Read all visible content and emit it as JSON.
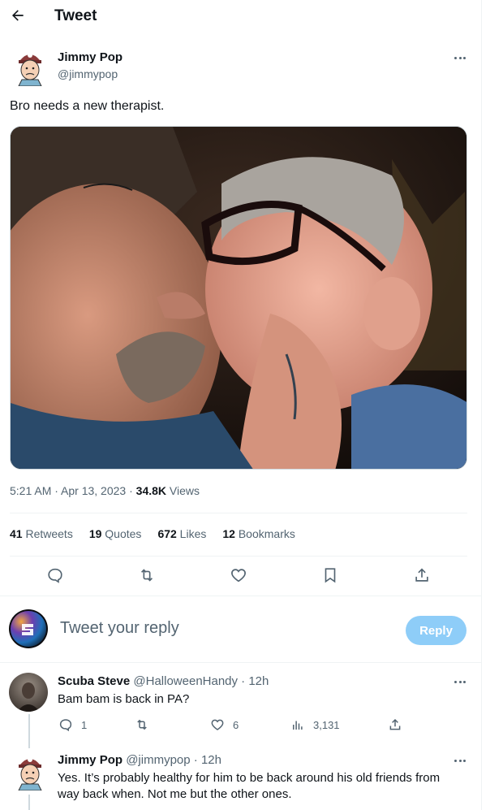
{
  "header": {
    "title": "Tweet"
  },
  "tweet": {
    "author_name": "Jimmy Pop",
    "author_handle": "@jimmypop",
    "text": "Bro needs a new therapist.",
    "time": "5:21 AM · Apr 13, 2023 · ",
    "views_count": "34.8K",
    "views_label": " Views"
  },
  "stats": {
    "retweets_count": "41",
    "retweets_label": " Retweets",
    "quotes_count": "19",
    "quotes_label": " Quotes",
    "likes_count": "672",
    "likes_label": " Likes",
    "bookmarks_count": "12",
    "bookmarks_label": " Bookmarks"
  },
  "composer": {
    "placeholder": "Tweet your reply",
    "reply_label": "Reply"
  },
  "replies": [
    {
      "name": "Scuba Steve",
      "handle_time": " @HalloweenHandy · 12h",
      "text": "Bam bam is back in PA?",
      "reply_count": "1",
      "retweet_count": "",
      "like_count": "6",
      "view_count": "3,131"
    },
    {
      "name": "Jimmy Pop",
      "handle_time": " @jimmypop · 12h",
      "text": "Yes.  It’s probably healthy for him to be back around his old friends from way back when.  Not me but the other ones."
    }
  ],
  "colors": {
    "accent": "#1d9bf0",
    "reply_button_disabled": "#8ecdf8",
    "muted": "#536471"
  },
  "icons": [
    "back-arrow-icon",
    "more-icon",
    "reply-icon",
    "retweet-icon",
    "like-icon",
    "bookmark-icon",
    "share-icon",
    "views-icon"
  ]
}
